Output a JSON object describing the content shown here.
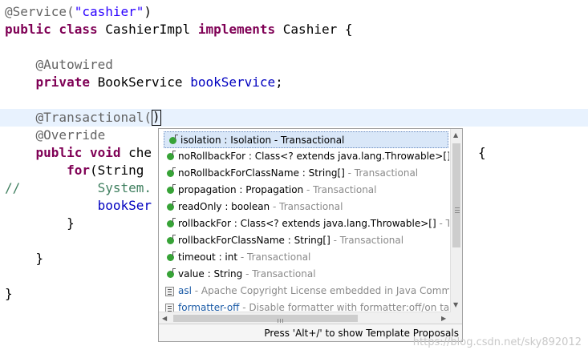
{
  "code": {
    "l1_ann": "@Service(",
    "l1_str": "\"cashier\"",
    "l1_end": ")",
    "l2_kw1": "public class",
    "l2_name": " CashierImpl ",
    "l2_kw2": "implements",
    "l2_rest": " Cashier {",
    "l4_ann": "    @Autowired",
    "l5_kw": "    private",
    "l5_type": " BookService ",
    "l5_field": "bookService",
    "l5_end": ";",
    "l7_ann": "    @Transactional(",
    "l7_end": ")",
    "l8_ann": "    @Override",
    "l9_kw": "    public void",
    "l9_rest": " che",
    "l9_tail": "{",
    "l10_kw": "        for",
    "l10_rest": "(String",
    "l11_cmt": "//",
    "l11_rest": "          System.",
    "l12_field": "            bookSer",
    "l13": "        }",
    "l15": "    }",
    "l17": "}"
  },
  "popup": {
    "items": [
      {
        "name": "isolation : Isolation - Transactional",
        "detail": "",
        "icon": "method-icon"
      },
      {
        "name": "noRollbackFor : Class<? extends java.lang.Throwable>[] -",
        "detail": "",
        "icon": "method-icon"
      },
      {
        "name": "noRollbackForClassName : String[]",
        "detail": " - Transactional",
        "icon": "method-icon"
      },
      {
        "name": "propagation : Propagation",
        "detail": " - Transactional",
        "icon": "method-icon"
      },
      {
        "name": "readOnly : boolean",
        "detail": " - Transactional",
        "icon": "method-icon"
      },
      {
        "name": "rollbackFor : Class<? extends java.lang.Throwable>[]",
        "detail": " - Tra",
        "icon": "method-icon"
      },
      {
        "name": "rollbackForClassName : String[]",
        "detail": " - Transactional",
        "icon": "method-icon"
      },
      {
        "name": "timeout : int",
        "detail": " - Transactional",
        "icon": "method-icon"
      },
      {
        "name": "value : String",
        "detail": " - Transactional",
        "icon": "method-icon"
      },
      {
        "name": "asl",
        "detail": " - Apache Copyright License embedded in Java Comme",
        "icon": "template-icon"
      },
      {
        "name": "formatter-off",
        "detail": " - Disable formatter with formatter:off/on tag",
        "icon": "template-icon"
      }
    ],
    "status": "Press 'Alt+/' to show Template Proposals"
  },
  "watermark": "https://blog.csdn.net/sky892012"
}
